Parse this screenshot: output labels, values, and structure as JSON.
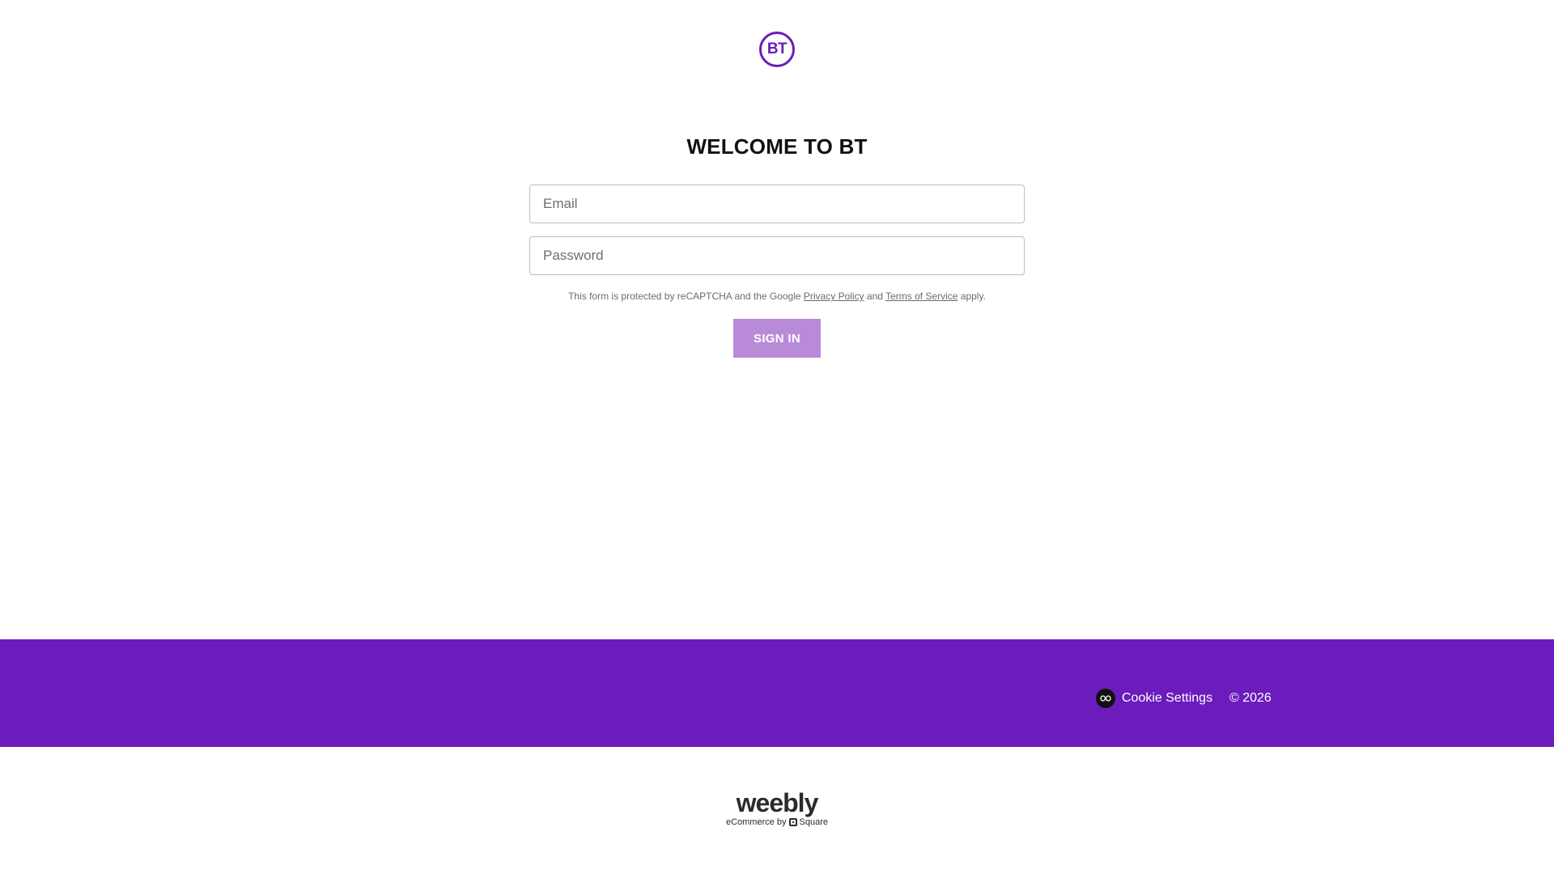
{
  "brand": {
    "logo_text": "BT",
    "color": "#6a1dbb"
  },
  "page": {
    "title": "WELCOME TO BT"
  },
  "form": {
    "email_placeholder": "Email",
    "password_placeholder": "Password",
    "recaptcha_prefix": "This form is protected by reCAPTCHA and the Google",
    "privacy_link": "Privacy Policy",
    "recaptcha_and": "and",
    "terms_link": "Terms of Service",
    "recaptcha_suffix": "apply.",
    "signin_label": "SIGN IN",
    "signin_color": "#b98ad8"
  },
  "footer": {
    "background": "#6c1bbd",
    "cookie_settings_label": "Cookie Settings",
    "cookie_icon": "cookie-settings-icon",
    "copyright": "© 2026"
  },
  "powered_by": {
    "wordmark": "weebly",
    "tagline_prefix": "eCommerce by",
    "square_icon": "square-logo-icon",
    "tagline_brand": "Square"
  }
}
